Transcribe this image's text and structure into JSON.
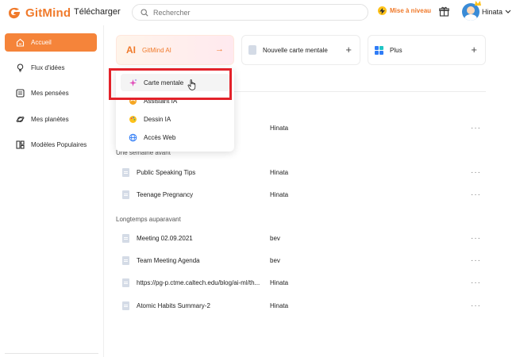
{
  "header": {
    "brand": "GitMind",
    "download": "Télécharger",
    "search_placeholder": "Rechercher",
    "upgrade": "Mise à niveau",
    "user_name": "Hinata"
  },
  "sidebar": {
    "items": [
      {
        "label": "Accueil",
        "icon": "home-icon",
        "active": true
      },
      {
        "label": "Flux d'idées",
        "icon": "bulb-icon",
        "active": false
      },
      {
        "label": "Mes pensées",
        "icon": "note-icon",
        "active": false
      },
      {
        "label": "Mes planètes",
        "icon": "planet-icon",
        "active": false
      },
      {
        "label": "Modèles Populaires",
        "icon": "templates-icon",
        "active": false
      }
    ]
  },
  "cards": {
    "ai_glyph": "AI",
    "ai_label": "GitMind AI",
    "ai_arrow": "→",
    "new_label": "Nouvelle carte mentale",
    "more_label": "Plus",
    "plus_glyph": "+"
  },
  "dropdown": {
    "items": [
      {
        "label": "Carte mentale",
        "icon": "sparkle-icon"
      },
      {
        "label": "Assistant IA",
        "icon": "assistant-icon"
      },
      {
        "label": "Dessin IA",
        "icon": "palette-icon"
      },
      {
        "label": "Accès Web",
        "icon": "globe-icon"
      }
    ]
  },
  "files": {
    "dots": "···",
    "top_owner": "Hinata",
    "sections": [
      {
        "label": "Une semaine avant",
        "rows": [
          {
            "title": "Public Speaking Tips",
            "owner": "Hinata"
          },
          {
            "title": "Teenage Pregnancy",
            "owner": "Hinata"
          }
        ]
      },
      {
        "label": "Longtemps auparavant",
        "rows": [
          {
            "title": "Meeting 02.09.2021",
            "owner": "bev"
          },
          {
            "title": "Team Meeting Agenda",
            "owner": "bev"
          },
          {
            "title": "https://pg-p.ctme.caltech.edu/blog/ai-ml/th...",
            "owner": "Hinata"
          },
          {
            "title": "Atomic Habits Summary-2",
            "owner": "Hinata"
          }
        ]
      }
    ]
  },
  "colors": {
    "accent": "#f5843a",
    "brand": "#f07a2b",
    "highlight": "#e3222a"
  }
}
